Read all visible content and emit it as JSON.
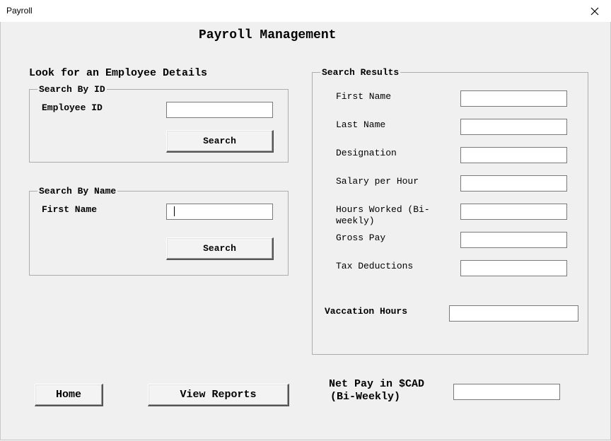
{
  "window": {
    "title": "Payroll"
  },
  "header": {
    "title": "Payroll Management"
  },
  "search_panel": {
    "heading": "Look for an Employee Details",
    "by_id": {
      "legend": "Search By ID",
      "label": "Employee ID",
      "value": "",
      "button": "Search"
    },
    "by_name": {
      "legend": "Search By Name",
      "label": "First Name",
      "value": "",
      "button": "Search"
    }
  },
  "results": {
    "legend": "Search Results",
    "fields": [
      {
        "label": "First Name",
        "value": ""
      },
      {
        "label": "Last Name",
        "value": ""
      },
      {
        "label": "Designation",
        "value": ""
      },
      {
        "label": "Salary per Hour",
        "value": ""
      },
      {
        "label": "Hours Worked (Bi-\nweekly)",
        "value": ""
      },
      {
        "label": "Gross Pay",
        "value": ""
      },
      {
        "label": "Tax Deductions",
        "value": ""
      }
    ],
    "vacation_label": "Vaccation Hours",
    "vacation_value": ""
  },
  "footer": {
    "home_button": "Home",
    "reports_button": "View Reports",
    "net_pay_label_line1": "Net Pay in $CAD",
    "net_pay_label_line2": "(Bi-Weekly)",
    "net_pay_value": ""
  }
}
